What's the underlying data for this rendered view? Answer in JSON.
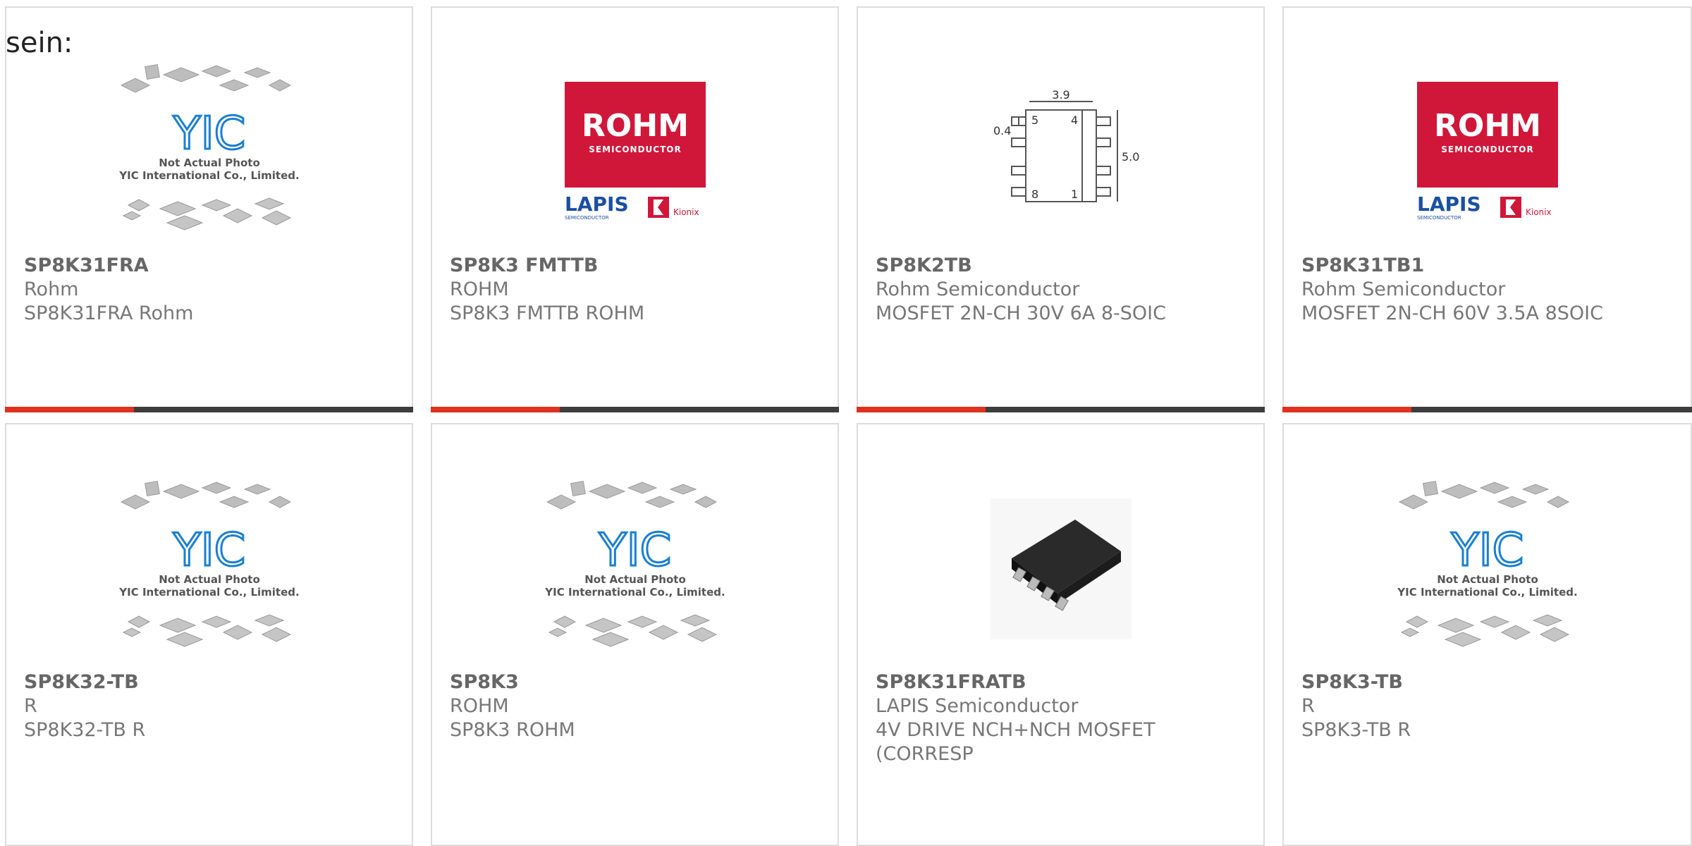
{
  "intro_text": "sein:",
  "colors": {
    "accent": "#e0301e",
    "bar": "#3d3d3d",
    "rohm_red": "#d0173a",
    "lapis_blue": "#1b4fa0",
    "yic_blue": "#1a7fd0"
  },
  "placeholder": {
    "logo_text": "YIC",
    "line1": "Not Actual Photo",
    "line2": "YIC International Co., Limited."
  },
  "rohm_logo": {
    "brand": "ROHM",
    "sub": "SEMICONDUCTOR",
    "lapis": "LAPIS",
    "lapis_sub": "SEMICONDUCTOR",
    "kionix": "Kionix"
  },
  "soic_diagram": {
    "dim_top": "3.9",
    "dim_side": "5.0",
    "dim_pin": "0.4",
    "pin_5": "5",
    "pin_4": "4",
    "pin_8": "8",
    "pin_1": "1"
  },
  "products": [
    {
      "part": "SP8K31FRA",
      "manufacturer": "Rohm",
      "description": "SP8K31FRA Rohm",
      "image": "yic-placeholder"
    },
    {
      "part": "SP8K3 FMTTB",
      "manufacturer": "ROHM",
      "description": "SP8K3 FMTTB ROHM",
      "image": "rohm-logo"
    },
    {
      "part": "SP8K2TB",
      "manufacturer": "Rohm Semiconductor",
      "description": "MOSFET 2N-CH 30V 6A 8-SOIC",
      "image": "soic-diagram"
    },
    {
      "part": "SP8K31TB1",
      "manufacturer": "Rohm Semiconductor",
      "description": "MOSFET 2N-CH 60V 3.5A 8SOIC",
      "image": "rohm-logo"
    },
    {
      "part": "SP8K32-TB",
      "manufacturer": "R",
      "description": "SP8K32-TB R",
      "image": "yic-placeholder"
    },
    {
      "part": "SP8K3",
      "manufacturer": "ROHM",
      "description": "SP8K3 ROHM",
      "image": "yic-placeholder"
    },
    {
      "part": "SP8K31FRATB",
      "manufacturer": "LAPIS Semiconductor",
      "description": "4V DRIVE NCH+NCH MOSFET",
      "description_line2": "(CORRESP",
      "image": "soic-chip-photo"
    },
    {
      "part": "SP8K3-TB",
      "manufacturer": "R",
      "description": "SP8K3-TB R",
      "image": "yic-placeholder"
    }
  ]
}
